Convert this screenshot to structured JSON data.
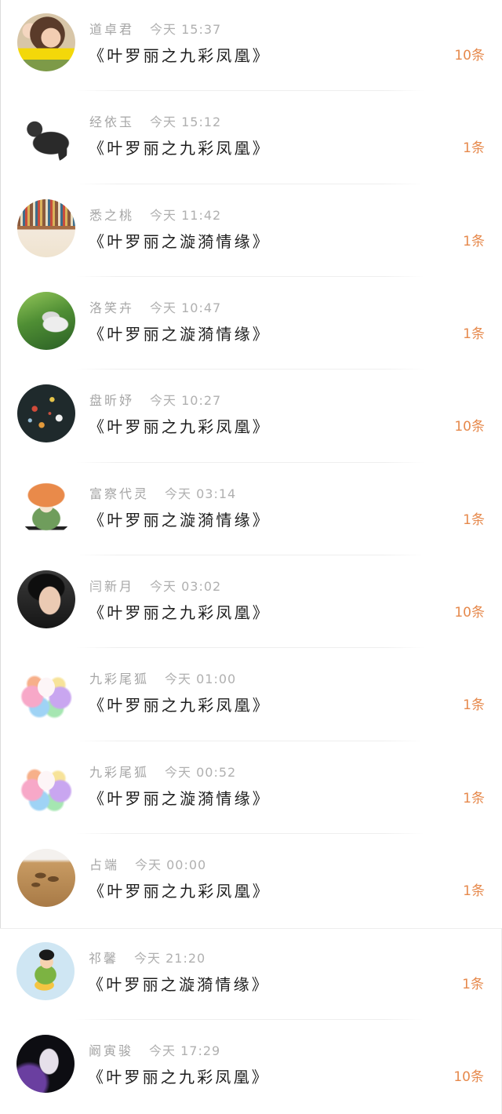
{
  "colors": {
    "accent": "#e6894c",
    "name_text": "#a6a6a6",
    "title_text": "#1e1e1e",
    "background": "#ffffff"
  },
  "messages": [
    {
      "name": "道卓君",
      "time": "今天 15:37",
      "title": "《叶罗丽之九彩凤凰》",
      "count": "10条"
    },
    {
      "name": "经依玉",
      "time": "今天 15:12",
      "title": "《叶罗丽之九彩凤凰》",
      "count": "1条"
    },
    {
      "name": "悉之桃",
      "time": "今天 11:42",
      "title": "《叶罗丽之漩漪情缘》",
      "count": "1条"
    },
    {
      "name": "洛笑卉",
      "time": "今天 10:47",
      "title": "《叶罗丽之漩漪情缘》",
      "count": "1条"
    },
    {
      "name": "盘昕妤",
      "time": "今天 10:27",
      "title": "《叶罗丽之九彩凤凰》",
      "count": "10条"
    },
    {
      "name": "富察代灵",
      "time": "今天 03:14",
      "title": "《叶罗丽之漩漪情缘》",
      "count": "1条"
    },
    {
      "name": "闫新月",
      "time": "今天 03:02",
      "title": "《叶罗丽之九彩凤凰》",
      "count": "10条"
    },
    {
      "name": "九彩尾狐",
      "time": "今天 01:00",
      "title": "《叶罗丽之九彩凤凰》",
      "count": "1条"
    },
    {
      "name": "九彩尾狐",
      "time": "今天 00:52",
      "title": "《叶罗丽之漩漪情缘》",
      "count": "1条"
    },
    {
      "name": "占端",
      "time": "今天 00:00",
      "title": "《叶罗丽之九彩凤凰》",
      "count": "1条"
    },
    {
      "name": "祁馨",
      "time": "今天 21:20",
      "title": "《叶罗丽之漩漪情缘》",
      "count": "1条"
    },
    {
      "name": "阚寅骏",
      "time": "今天 17:29",
      "title": "《叶罗丽之九彩凤凰》",
      "count": "10条"
    }
  ]
}
